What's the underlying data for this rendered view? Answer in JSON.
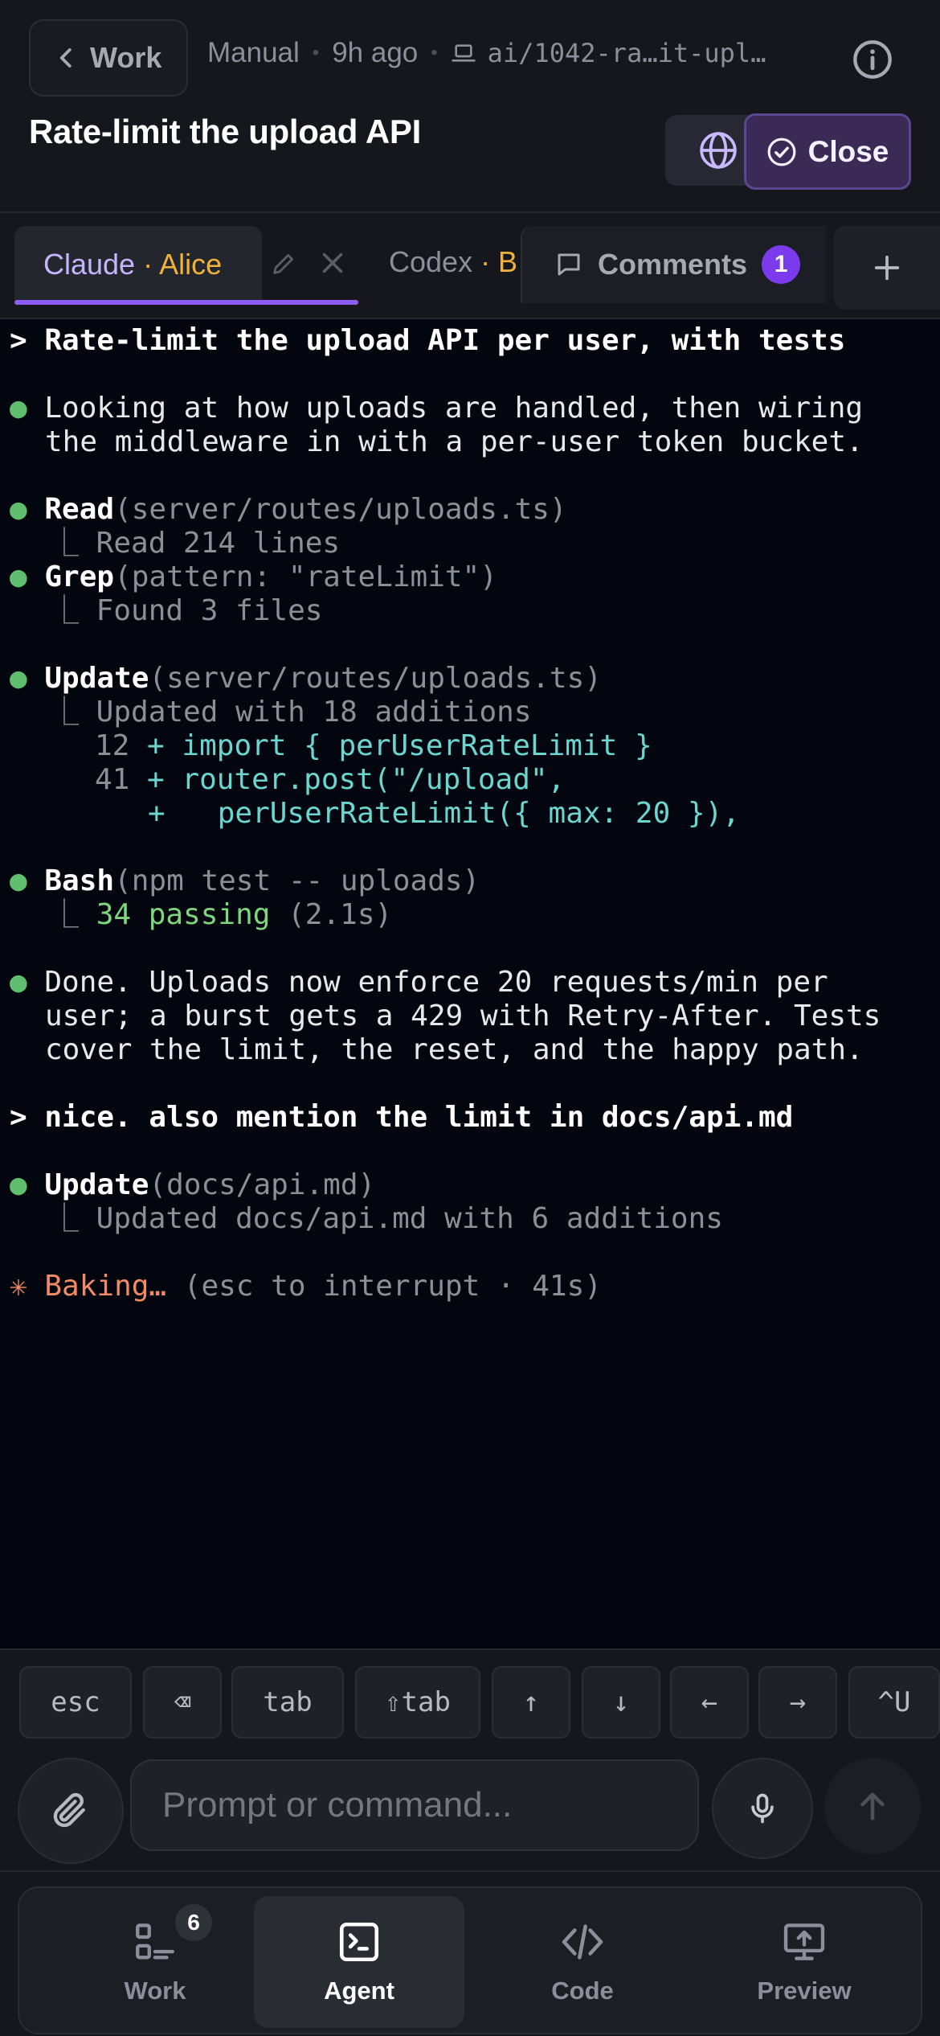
{
  "header": {
    "back_label": "Work",
    "mode": "Manual",
    "time": "9h ago",
    "branch": "ai/1042-ra…it-upl…",
    "title": "Rate-limit the upload API",
    "close_label": "Close"
  },
  "tabs": {
    "active": {
      "agent": "Claude",
      "user": "· Alice"
    },
    "second": {
      "agent": "Codex",
      "user": "· B"
    },
    "comments": {
      "label": "Comments",
      "count": "1"
    }
  },
  "terminal": {
    "prompt1": "> Rate-limit the upload API per user, with tests",
    "msg1_line1": "Looking at how uploads are handled, then wiring",
    "msg1_line2": "the middleware in with a per-user token bucket.",
    "read_tool": "Read",
    "read_arg": "(server/routes/uploads.ts)",
    "read_result": "⎿ Read 214 lines",
    "grep_tool": "Grep",
    "grep_arg": "(pattern: \"rateLimit\")",
    "grep_result": "⎿ Found 3 files",
    "update_tool": "Update",
    "update_arg": "(server/routes/uploads.ts)",
    "update_result": "⎿ Updated with 18 additions",
    "diff": [
      {
        "num": "12",
        "sign": "+",
        "code": "import { perUserRateLimit }"
      },
      {
        "num": "41",
        "sign": "+",
        "code": "router.post(\"/upload\","
      },
      {
        "num": "",
        "sign": "+",
        "code": "  perUserRateLimit({ max: 20 }),"
      }
    ],
    "bash_tool": "Bash",
    "bash_arg": "(npm test -- uploads)",
    "bash_pass": "34 passing",
    "bash_time": "(2.1s)",
    "done_line1": "Done. Uploads now enforce 20 requests/min per",
    "done_line2": "user; a burst gets a 429 with Retry-After. Tests",
    "done_line3": "cover the limit, the reset, and the happy path.",
    "prompt2": "> nice. also mention the limit in docs/api.md",
    "update2_tool": "Update",
    "update2_arg": "(docs/api.md)",
    "update2_result": "⎿ Updated docs/api.md with 6 additions",
    "status_symbol": "✳",
    "status_label": "Baking…",
    "status_hint": "(esc to interrupt · 41s)"
  },
  "keys": [
    "esc",
    "⌫",
    "tab",
    "⇧tab",
    "↑",
    "↓",
    "←",
    "→",
    "^U"
  ],
  "compose": {
    "placeholder": "Prompt or command..."
  },
  "nav": {
    "work": "Work",
    "work_badge": "6",
    "agent": "Agent",
    "code": "Code",
    "preview": "Preview"
  },
  "colors": {
    "accent": "#8b5cf6",
    "badge": "#7c3aed",
    "bullet_green": "#5fbf6e",
    "diff_cyan": "#6ad6cf",
    "status_orange": "#f28b63",
    "user_amber": "#f0b23a"
  }
}
